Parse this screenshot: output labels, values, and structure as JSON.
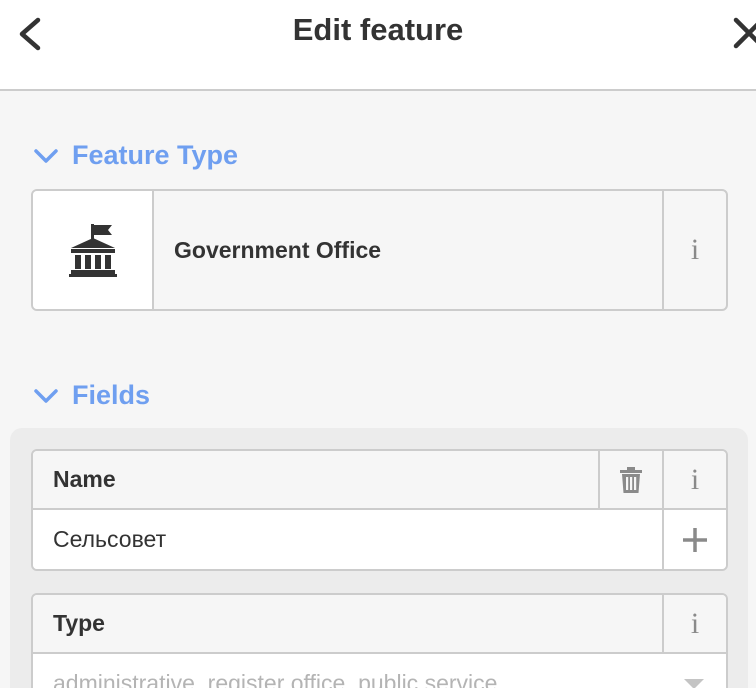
{
  "header": {
    "title": "Edit feature",
    "back_icon": "chevron-left-icon",
    "close_icon": "close-icon"
  },
  "feature_type": {
    "section_label": "Feature Type",
    "preset_name": "Government Office",
    "preset_icon": "government-building-icon",
    "info_label": "i"
  },
  "fields": {
    "section_label": "Fields",
    "name": {
      "label": "Name",
      "value": "Сельсовет",
      "info_label": "i",
      "delete_icon": "trash-icon",
      "add_icon": "plus-icon"
    },
    "type": {
      "label": "Type",
      "placeholder": "administrative, register office, public service",
      "info_label": "i",
      "dropdown_icon": "caret-down-icon"
    }
  },
  "colors": {
    "accent": "#6f9ff0",
    "border": "#cccccc",
    "panel": "#ececec",
    "background": "#f6f6f6"
  }
}
